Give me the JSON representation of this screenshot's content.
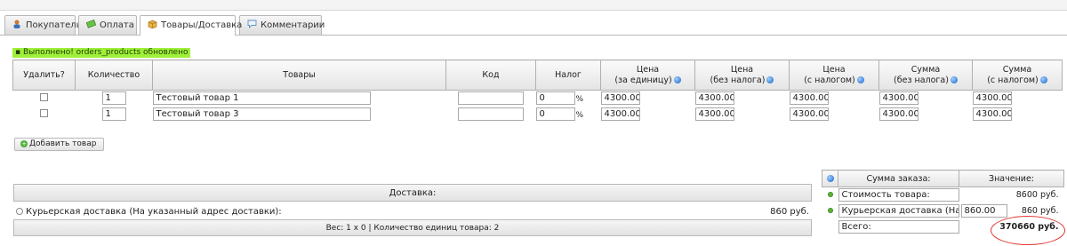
{
  "tabs": [
    {
      "label": "Покупатель",
      "icon": "user-icon",
      "active": false
    },
    {
      "label": "Оплата",
      "icon": "money-icon",
      "active": false
    },
    {
      "label": "Товары/Доставка",
      "icon": "box-icon",
      "active": true
    },
    {
      "label": "Комментарии",
      "icon": "comment-icon",
      "active": false
    }
  ],
  "status_message": "Выполнено! orders_products обновлено",
  "products_table": {
    "headers": {
      "delete": "Удалить?",
      "qty": "Количество",
      "product": "Товары",
      "code": "Код",
      "tax": "Налог",
      "price_unit_1": "Цена",
      "price_unit_2": "(за единицу)",
      "price_net_1": "Цена",
      "price_net_2": "(без налога)",
      "price_gross_1": "Цена",
      "price_gross_2": "(с налогом)",
      "sum_net_1": "Сумма",
      "sum_net_2": "(без налога)",
      "sum_gross_1": "Сумма",
      "sum_gross_2": "(с налогом)"
    },
    "rows": [
      {
        "qty": "1",
        "name": "Тестовый товар 1",
        "code": "",
        "tax": "0",
        "tax_unit": "%",
        "price_unit": "4300.00",
        "price_net": "4300.00",
        "price_gross": "4300.00",
        "sum_net": "4300.00",
        "sum_gross": "4300.00"
      },
      {
        "qty": "1",
        "name": "Тестовый товар 3",
        "code": "",
        "tax": "0",
        "tax_unit": "%",
        "price_unit": "4300.00",
        "price_net": "4300.00",
        "price_gross": "4300.00",
        "sum_net": "4300.00",
        "sum_gross": "4300.00"
      }
    ]
  },
  "add_product_label": "Добавить товар",
  "shipping": {
    "header": "Доставка:",
    "option_label": "Курьерская доставка (На указанный адрес доставки):",
    "option_price": "860 руб.",
    "weight_info": "Вес: 1 x 0 | Количество единиц товара: 2"
  },
  "summary": {
    "col_title": "Сумма заказа:",
    "col_value": "Значение:",
    "rows": [
      {
        "label": "Стоимость товара:",
        "input": "",
        "value": "8600 руб."
      },
      {
        "label": "Курьерская доставка (На",
        "input": "860.00",
        "value": "860 руб."
      }
    ],
    "total_label": "Всего:",
    "total_value": "370660 руб."
  },
  "colors": {
    "success_bg": "#9ff03a",
    "highlight_circle": "#e0332c",
    "info_icon": "#1762c9"
  }
}
